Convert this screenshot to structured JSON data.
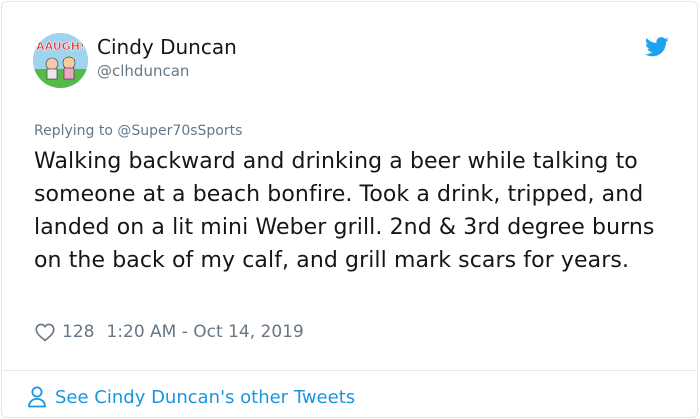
{
  "tweet": {
    "author_name": "Cindy Duncan",
    "author_handle": "@clhduncan",
    "avatar_text": "AAUGH!",
    "reply_prefix": "Replying to",
    "reply_to": "@Super70sSports",
    "text": "Walking backward and drinking a beer while talking to someone at a beach bonfire. Took a drink, tripped, and landed on a lit mini Weber grill. 2nd & 3rd degree burns on the back of my calf, and grill mark scars for years.",
    "like_count": "128",
    "timestamp": "1:20 AM - Oct 14, 2019"
  },
  "footer": {
    "link_text": "See Cindy Duncan's other Tweets"
  },
  "icons": {
    "brand": "twitter-bird-icon",
    "like": "heart-icon",
    "profile": "person-icon"
  },
  "colors": {
    "accent": "#1da1f2",
    "link": "#1b95e0",
    "muted": "#657786",
    "text": "#14171a",
    "border": "#e1e8ed"
  }
}
